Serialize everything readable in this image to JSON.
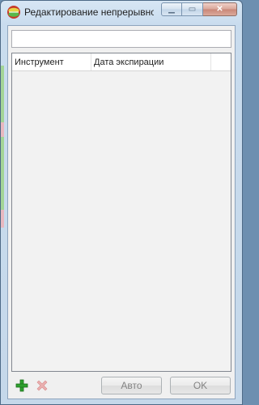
{
  "window": {
    "title": "Редактирование непрерывно...",
    "icon": "app-logo-icon",
    "caption_buttons": [
      {
        "name": "minimize-icon",
        "glyph": "▁"
      },
      {
        "name": "maximize-icon",
        "glyph": "▭"
      },
      {
        "name": "close-icon",
        "glyph": "✕"
      }
    ]
  },
  "search": {
    "value": "",
    "placeholder": ""
  },
  "table": {
    "columns": [
      "Инструмент",
      "Дата экспирации",
      ""
    ],
    "rows": []
  },
  "toolbar": {
    "add_icon": "plus-icon",
    "delete_icon": "delete-x-icon",
    "auto_label": "Авто",
    "ok_label": "OK"
  },
  "colors": {
    "add_green": "#2ea12e",
    "delete_red": "#e8a0a0",
    "disabled_text": "#838383"
  }
}
